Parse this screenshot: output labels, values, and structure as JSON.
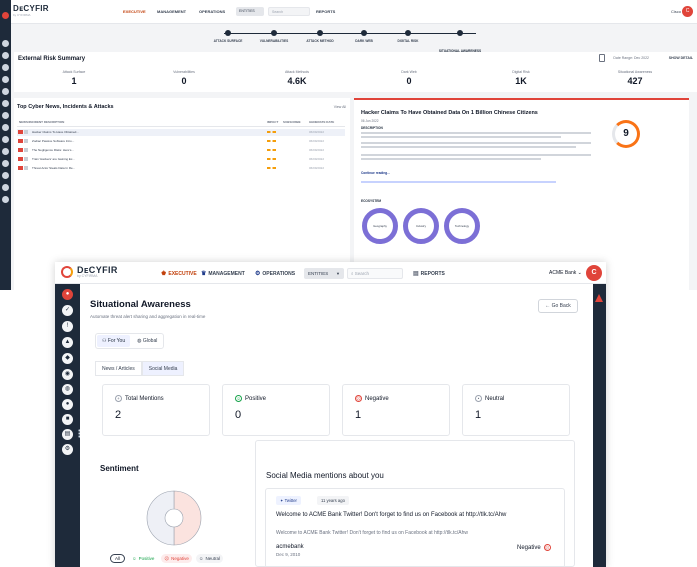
{
  "back": {
    "logo": "DᴇCYFIR",
    "logo_sub": "by CYFIRMA",
    "nav": [
      "EXECUTIVE",
      "MANAGEMENT",
      "OPERATIONS"
    ],
    "entity_select": "ENTITIES",
    "search_placeholder": "Search",
    "reports": "REPORTS",
    "user": "Cisco",
    "avatar": "C",
    "stepper": [
      "ATTACK SURFACE",
      "VULNERABILITIES",
      "ATTACK METHOD",
      "DARK WEB",
      "DIGITAL RISK",
      "SITUATIONAL AWARENESS"
    ],
    "summary_title": "External Risk Summary",
    "summary_date_label": "Date Range: Dec 2022",
    "summary_btn": "SHOW DETAIL",
    "stats": [
      {
        "label": "Attack Surface",
        "value": "1"
      },
      {
        "label": "Vulnerabilities",
        "value": "0"
      },
      {
        "label": "Attack Methods",
        "value": "4.6K"
      },
      {
        "label": "Dark Web",
        "value": "0"
      },
      {
        "label": "Digital Risk",
        "value": "1K"
      },
      {
        "label": "Situational Awareness",
        "value": "427"
      }
    ],
    "news_title": "Top Cyber News, Incidents & Attacks",
    "news_viewall": "View All",
    "news_headers": [
      "NEWS/INCIDENT DESCRIPTION",
      "IMPACT",
      "SUBSCRIBE",
      "GENERATE DATE"
    ],
    "news_rows": [
      {
        "title": "Hacker Claims To Have Obtained...",
        "date": "06/09/2022"
      },
      {
        "title": "Zodiac Passive Software Intro...",
        "date": "06/09/2022"
      },
      {
        "title": "The Negligence Risks: Here's...",
        "date": "06/09/2022"
      },
      {
        "title": "Train 'Hackers' are Gaining Ex...",
        "date": "06/09/2022"
      },
      {
        "title": "Threat Actor Steals Data In Re...",
        "date": "06/09/2022"
      }
    ],
    "detail_title": "Hacker Claims To Have Obtained Data On 1 Billion Chinese Citizens",
    "detail_sub": "06 Jun 2022",
    "detail_sections": [
      "DESCRIPTION",
      "Continue reading..."
    ],
    "detail_score": "9",
    "detail_ecosystem": "ECOSYSTEM",
    "detail_rings": [
      "Geography",
      "Industry",
      "Technology"
    ],
    "detail_threat": "Threat Actor"
  },
  "front": {
    "logo": "DᴇCYFIR",
    "logo_sub": "by CYFIRMA",
    "nav": {
      "executive": "EXECUTIVE",
      "management": "MANAGEMENT",
      "operations": "OPERATIONS"
    },
    "entity_select": "ENTITIES",
    "search_placeholder": "Search",
    "reports": "REPORTS",
    "user": "ACME Bank",
    "avatar": "C",
    "title": "Situational Awareness",
    "subtitle": "Automate threat alert sharing and aggregation in real-time",
    "go_back": "Go Back",
    "scope": {
      "for_you": "For You",
      "global": "Global"
    },
    "tabs": {
      "news": "News / Articles",
      "social": "Social Media"
    },
    "cards": [
      {
        "label": "Total Mentions",
        "value": "2",
        "icon": "+",
        "color": "#6b7280"
      },
      {
        "label": "Positive",
        "value": "0",
        "icon": "☺",
        "color": "#16a34a"
      },
      {
        "label": "Negative",
        "value": "1",
        "icon": "☹",
        "color": "#e0443a"
      },
      {
        "label": "Neutral",
        "value": "1",
        "icon": "•",
        "color": "#6b7280"
      }
    ],
    "sentiment_title": "Sentiment",
    "legend": {
      "all": "All",
      "positive": "Positive",
      "negative": "Negative",
      "neutral": "Neutral"
    },
    "social_title": "Social Media mentions about you",
    "post": {
      "source": "Twitter",
      "age": "11 years ago",
      "message": "Welcome to ACME Bank Twitter! Don't forget to find us on Facebook at http://tlk.tc/Ahw",
      "message_repeat": "Welcome to ACME Bank Twitter! Don't forget to find us on Facebook at http://tlk.tc/Ahw",
      "author": "acmebank",
      "date": "Dec 9, 2010",
      "sentiment": "Negative"
    }
  },
  "chart_data": {
    "type": "pie",
    "title": "Sentiment",
    "categories": [
      "Positive",
      "Negative",
      "Neutral"
    ],
    "values": [
      0,
      1,
      1
    ],
    "colors": {
      "Positive": "#16a34a",
      "Negative": "#fbe3df",
      "Neutral": "#eef0f6"
    }
  }
}
